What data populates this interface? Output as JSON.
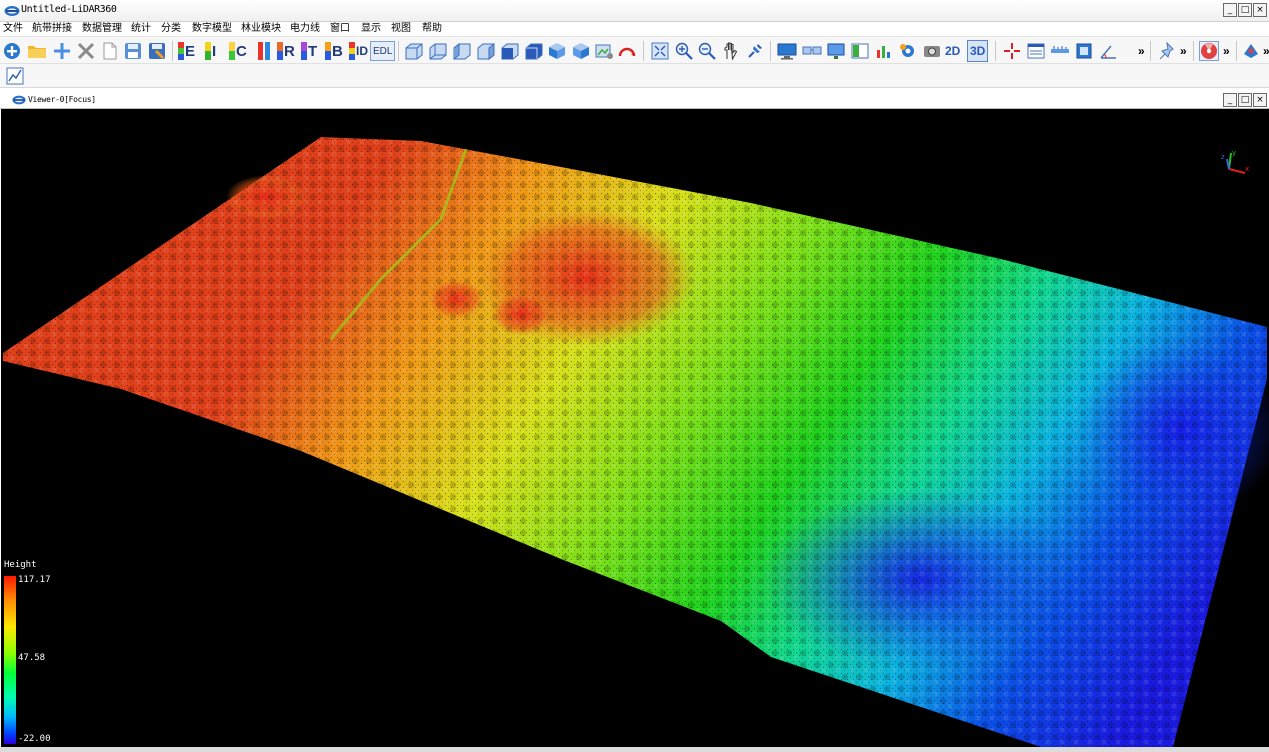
{
  "window": {
    "title": "Untitled-LiDAR360",
    "minimize": "_",
    "maximize": "□",
    "close": "×"
  },
  "menu": [
    "文件",
    "航带拼接",
    "数据管理",
    "统计",
    "分类",
    "数字模型",
    "林业模块",
    "电力线",
    "窗口",
    "显示",
    "视图",
    "帮助"
  ],
  "toolbar": {
    "letter_buttons": [
      "E",
      "I",
      "C",
      "R",
      "T",
      "B",
      "ID"
    ],
    "edl": "EDL",
    "view_2d": "2D",
    "view_3d": "3D",
    "overflow": "»"
  },
  "viewer": {
    "title": "Viewer-0[Focus]",
    "minimize": "_",
    "maximize": "□",
    "close": "×"
  },
  "legend": {
    "title": "Height",
    "max": "117.17",
    "mid": "47.58",
    "min": "-22.00"
  },
  "axes": {
    "x": "x",
    "y": "y",
    "z": "z"
  },
  "colors": {
    "terrain_high": "#e0301a",
    "terrain_mid": "#22d41a",
    "terrain_low": "#0a30e0",
    "background": "#000000"
  }
}
